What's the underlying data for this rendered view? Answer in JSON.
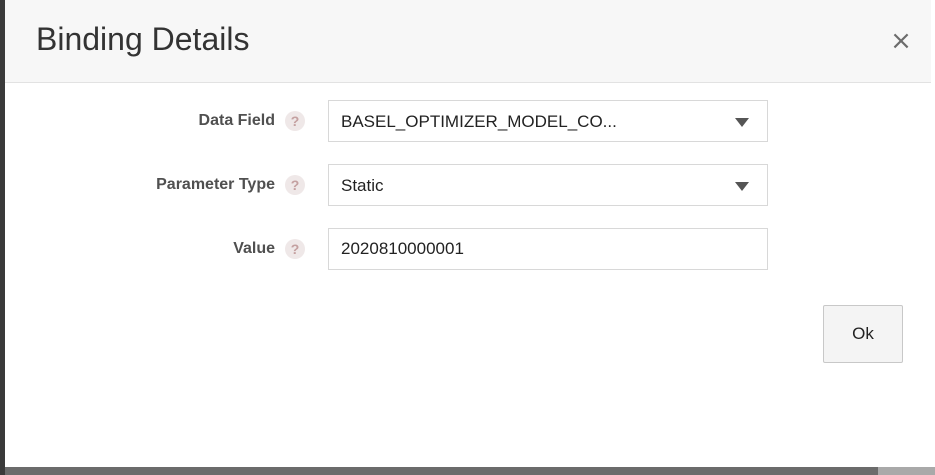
{
  "dialog": {
    "title": "Binding Details",
    "close_icon": "close-icon",
    "close_glyph": "×"
  },
  "form": {
    "data_field": {
      "label": "Data Field",
      "help_glyph": "?",
      "value": "BASEL_OPTIMIZER_MODEL_CO..."
    },
    "parameter_type": {
      "label": "Parameter Type",
      "help_glyph": "?",
      "value": "Static"
    },
    "value_field": {
      "label": "Value",
      "help_glyph": "?",
      "value": "2020810000001"
    }
  },
  "footer": {
    "ok_label": "Ok"
  },
  "colors": {
    "header_bg": "#f7f7f7",
    "label_text": "#505050",
    "help_icon": "#c4a0a0"
  }
}
